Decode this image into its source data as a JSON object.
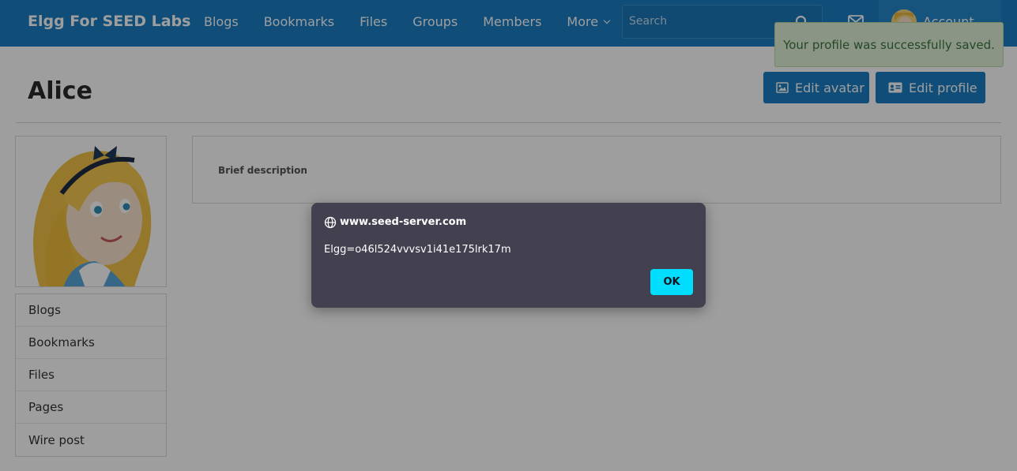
{
  "header": {
    "site_name": "Elgg For SEED Labs",
    "nav": [
      "Blogs",
      "Bookmarks",
      "Files",
      "Groups",
      "Members"
    ],
    "more_label": "More",
    "search_placeholder": "Search",
    "account_label": "Account",
    "icons": [
      "search-icon",
      "mail-icon",
      "chevron-down-icon",
      "avatar"
    ]
  },
  "notification": {
    "text": "Your profile was successfully saved."
  },
  "profile": {
    "name": "Alice",
    "edit_avatar_label": "Edit avatar",
    "edit_profile_label": "Edit profile",
    "brief_description_label": "Brief description"
  },
  "sidebar": {
    "items": [
      "Blogs",
      "Bookmarks",
      "Files",
      "Pages",
      "Wire post"
    ]
  },
  "dialog": {
    "origin": "www.seed-server.com",
    "message": "Elgg=o46l524vvvsv1i41e175lrk17m",
    "ok_label": "OK"
  },
  "colors": {
    "header": "#1b7fc3",
    "dialog_bg": "#434050",
    "ok_button": "#00ddff",
    "toast_bg": "#dff0d8",
    "toast_text": "#3c763d"
  }
}
